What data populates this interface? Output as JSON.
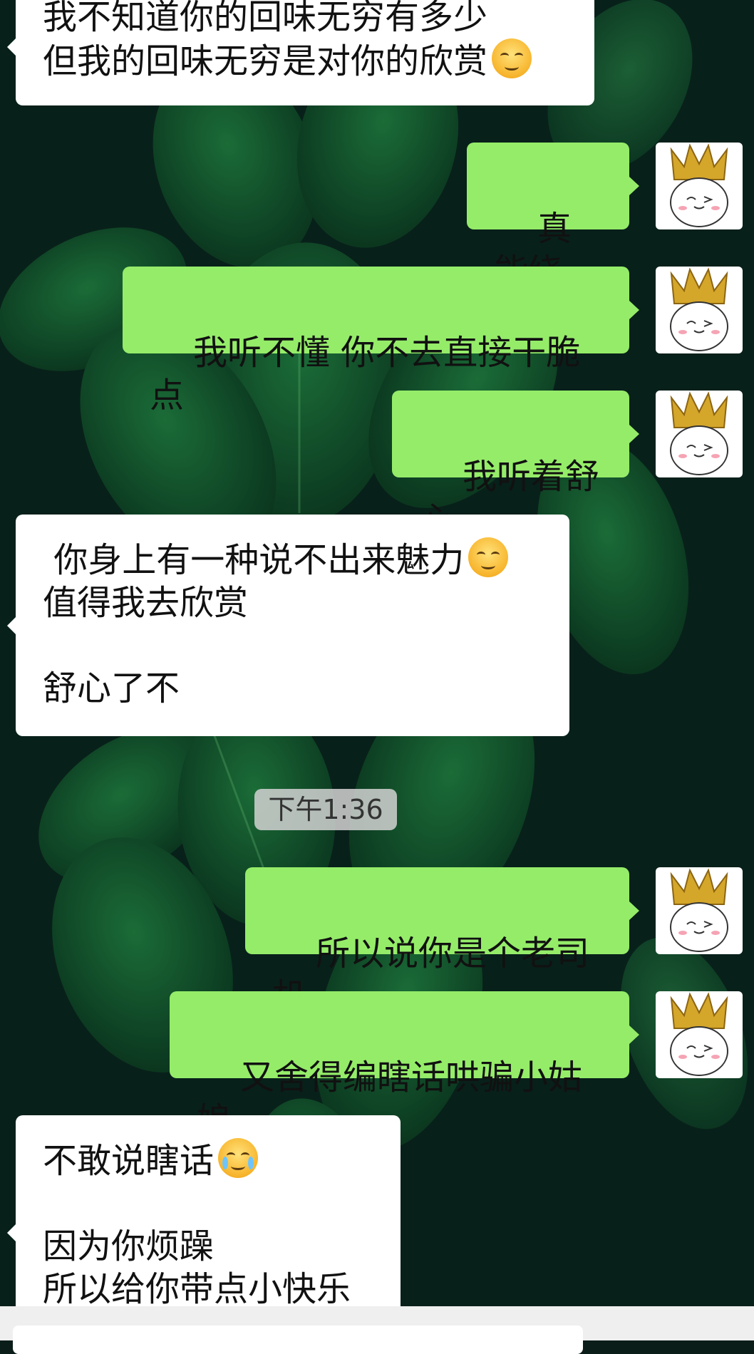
{
  "messages": [
    {
      "dir": "in",
      "lines": [
        "我不知道你的回味无穷有多少",
        "但我的回味无穷是对你的欣赏"
      ],
      "emoji": "smirk-emoji"
    },
    {
      "dir": "out",
      "text": "真能绕",
      "avatar": "crown-bun-avatar"
    },
    {
      "dir": "out",
      "text": "我听不懂 你不去直接干脆点",
      "avatar": "crown-bun-avatar"
    },
    {
      "dir": "out",
      "text": "我听着舒心",
      "avatar": "crown-bun-avatar"
    },
    {
      "dir": "in",
      "lines": [
        " 你身上有一种说不出来魅力",
        "值得我去欣赏",
        "",
        "舒心了不"
      ],
      "emoji": "smirk-emoji"
    },
    {
      "dir": "out",
      "text": "所以说你是个老司机",
      "avatar": "crown-bun-avatar"
    },
    {
      "dir": "out",
      "text": "又舍得编瞎话哄骗小姑娘",
      "avatar": "crown-bun-avatar"
    },
    {
      "dir": "in",
      "lines": [
        "不敢说瞎话",
        "",
        "因为你烦躁",
        "所以给你带点小快乐"
      ],
      "emoji": "laugh-cry-emoji"
    }
  ],
  "timestamp": "下午1:36",
  "colors": {
    "incoming": "#ffffff",
    "outgoing": "#95ec69",
    "background": "#0b1d18"
  }
}
